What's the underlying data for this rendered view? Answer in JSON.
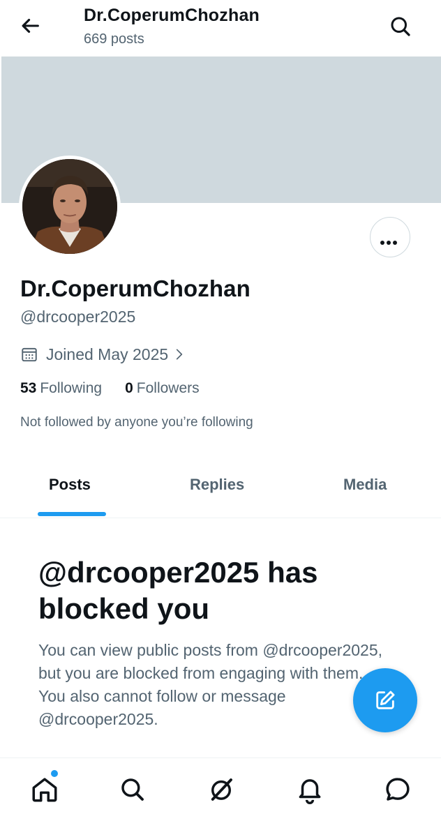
{
  "header": {
    "title": "Dr.CoperumChozhan",
    "post_count": "669 posts",
    "back_icon": "arrow-left-icon",
    "search_icon": "search-icon"
  },
  "profile": {
    "display_name": "Dr.CoperumChozhan",
    "handle": "@drcooper2025",
    "joined": "Joined May 2025",
    "following_count": "53",
    "following_label": "Following",
    "followers_count": "0",
    "followers_label": "Followers",
    "not_followed_text": "Not followed by anyone you’re following"
  },
  "tabs": [
    {
      "label": "Posts",
      "active": true
    },
    {
      "label": "Replies",
      "active": false
    },
    {
      "label": "Media",
      "active": false
    }
  ],
  "blocked": {
    "title": "@drcooper2025 has blocked you",
    "body": "You can view public posts from @drcooper2025, but you are blocked from engaging with them. You also cannot follow or message @drcooper2025."
  },
  "bottom_nav": [
    {
      "name": "home",
      "icon": "home-icon",
      "has_badge": true
    },
    {
      "name": "search",
      "icon": "search-icon"
    },
    {
      "name": "grok",
      "icon": "grok-icon"
    },
    {
      "name": "notifications",
      "icon": "bell-icon"
    },
    {
      "name": "messages",
      "icon": "message-icon"
    }
  ],
  "colors": {
    "accent": "#1d9bf0",
    "banner": "#cfd9de",
    "secondary_text": "#536471",
    "primary_text": "#0f1419"
  }
}
